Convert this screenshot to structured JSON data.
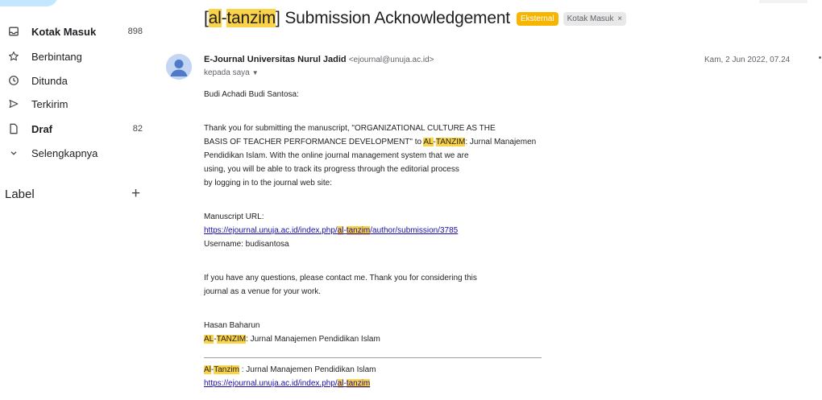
{
  "sidebar": {
    "items": [
      {
        "label": "Kotak Masuk",
        "count": "898",
        "icon": "inbox-icon"
      },
      {
        "label": "Berbintang",
        "count": "",
        "icon": "star-icon"
      },
      {
        "label": "Ditunda",
        "count": "",
        "icon": "clock-icon"
      },
      {
        "label": "Terkirim",
        "count": "",
        "icon": "send-icon"
      },
      {
        "label": "Draf",
        "count": "82",
        "icon": "file-icon"
      },
      {
        "label": "Selengkapnya",
        "count": "",
        "icon": "chevron-down-icon"
      }
    ],
    "labels_heading": "Label",
    "labels_add": "+"
  },
  "email": {
    "subject_prefix": "[",
    "subject_tag_a": "al",
    "subject_tag_dash": "-",
    "subject_tag_b": "tanzim",
    "subject_rest": "] Submission Acknowledgement",
    "badge_external": "Eksternal",
    "badge_inbox": "Kotak Masuk",
    "badge_inbox_close": "×",
    "sender_name": "E-Journal Universitas Nurul Jadid",
    "sender_email": "<ejournal@unuja.ac.id>",
    "recipient": "kepada saya",
    "date": "Kam, 2 Jun 2022, 07.24",
    "greeting": "Budi Achadi Budi Santosa:",
    "p1_line1": "Thank you for submitting the manuscript, \"ORGANIZATIONAL CULTURE AS THE",
    "p1_line2_pre": "BASIS OF TEACHER PERFORMANCE DEVELOPMENT\" to ",
    "p1_line2_hl_a": "AL",
    "p1_line2_dash": "-",
    "p1_line2_hl_b": "TANZIM",
    "p1_line2_post": ": Jurnal Manajemen",
    "p1_line3": "Pendidikan Islam. With the online journal management system that we are",
    "p1_line4": "using, you will be able to track its progress through the editorial process",
    "p1_line5": "by logging in to the journal web site:",
    "url_label": "Manuscript URL:",
    "url_pre": "https://ejournal.unuja.ac.id/index.php/",
    "url_hl_a": "al",
    "url_dash": "-",
    "url_hl_b": "tanzim",
    "url_post": "/author/submission/3785",
    "username": "Username: budisantosa",
    "p2_line1": "If you have any questions, please contact me. Thank you for considering this",
    "p2_line2": "journal as a venue for your work.",
    "sig_name": "Hasan Baharun",
    "sig_journal_hl_a": "AL",
    "sig_journal_dash": "-",
    "sig_journal_hl_b": "TANZIM",
    "sig_journal_post": ": Jurnal Manajemen Pendidikan Islam",
    "footer_hl_a": "Al",
    "footer_dash": "-",
    "footer_hl_b": "Tanzim",
    "footer_post": " : Jurnal Manajemen Pendidikan Islam",
    "footer_url_pre": "https://ejournal.unuja.ac.id/index.php/",
    "footer_url_hl_a": "al",
    "footer_url_dash": "-",
    "footer_url_hl_b": "tanzim"
  },
  "colors": {
    "highlight": "#fbd349",
    "external_badge": "#f7b500",
    "link": "#1a0dab"
  }
}
